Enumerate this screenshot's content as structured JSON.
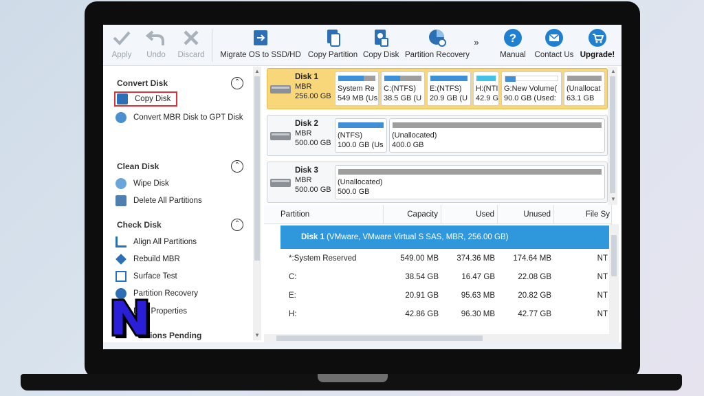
{
  "toolbar": {
    "apply": "Apply",
    "undo": "Undo",
    "discard": "Discard",
    "migrate_os": "Migrate OS to SSD/HD",
    "copy_partition": "Copy Partition",
    "copy_disk": "Copy Disk",
    "partition_recovery": "Partition Recovery",
    "more": "»",
    "manual": "Manual",
    "contact_us": "Contact Us",
    "upgrade": "Upgrade!"
  },
  "sidebar": {
    "convert_disk": {
      "title": "Convert Disk",
      "items": [
        "Copy Disk",
        "Convert MBR Disk to GPT Disk"
      ]
    },
    "clean_disk": {
      "title": "Clean Disk",
      "items": [
        "Wipe Disk",
        "Delete All Partitions"
      ]
    },
    "check_disk": {
      "title": "Check Disk",
      "items": [
        "Align All Partitions",
        "Rebuild MBR",
        "Surface Test",
        "Partition Recovery",
        "Disk Properties"
      ]
    },
    "operations_pending": "ions Pending"
  },
  "disks": [
    {
      "name": "Disk 1",
      "type": "MBR",
      "size": "256.00 GB",
      "partitions": [
        {
          "l1": "System Re",
          "l2": "549 MB (Us",
          "fill": 0.68
        },
        {
          "l1": "C:(NTFS)",
          "l2": "38.5 GB (U",
          "fill": 0.43
        },
        {
          "l1": "E:(NTFS)",
          "l2": "20.9 GB (U",
          "fill": 1.0
        },
        {
          "l1": "H:(NTI",
          "l2": "42.9 G",
          "fill": 1.0
        },
        {
          "l1": "G:New Volume(",
          "l2": "90.0 GB (Used:",
          "fill": 0.2
        },
        {
          "l1": "(Unallocat",
          "l2": "63.1 GB",
          "fill": 0.0
        }
      ]
    },
    {
      "name": "Disk 2",
      "type": "MBR",
      "size": "500.00 GB",
      "partitions": [
        {
          "l1": "(NTFS)",
          "l2": "100.0 GB (Us",
          "fill": 1.0
        },
        {
          "l1": "(Unallocated)",
          "l2": "400.0 GB",
          "fill": 0.0
        }
      ]
    },
    {
      "name": "Disk 3",
      "type": "MBR",
      "size": "500.00 GB",
      "partitions": [
        {
          "l1": "(Unallocated)",
          "l2": "500.0 GB",
          "fill": 0.0
        }
      ]
    }
  ],
  "table": {
    "headers": [
      "Partition",
      "Capacity",
      "Used",
      "Unused",
      "File Sy"
    ],
    "disk1_name": "Disk 1",
    "disk1_desc": "(VMware, VMware Virtual S SAS, MBR, 256.00 GB)",
    "rows": [
      {
        "partition": "*:System Reserved",
        "capacity": "549.00 MB",
        "used": "374.36 MB",
        "unused": "174.64 MB",
        "fs": "NT"
      },
      {
        "partition": "C:",
        "capacity": "38.54 GB",
        "used": "16.47 GB",
        "unused": "22.08 GB",
        "fs": "NT"
      },
      {
        "partition": "E:",
        "capacity": "20.91 GB",
        "used": "95.63 MB",
        "unused": "20.82 GB",
        "fs": "NT"
      },
      {
        "partition": "H:",
        "capacity": "42.86 GB",
        "used": "96.30 MB",
        "unused": "42.77 GB",
        "fs": "NT"
      }
    ]
  },
  "colors": {
    "selected_disk": "#f8d77a",
    "used_bar": "#3d8fd6",
    "unalloc_bar": "#9e9e9e",
    "row_highlight": "#2f98dc",
    "logo_fill": "#2a1fd6",
    "callout": "#e0303a"
  }
}
